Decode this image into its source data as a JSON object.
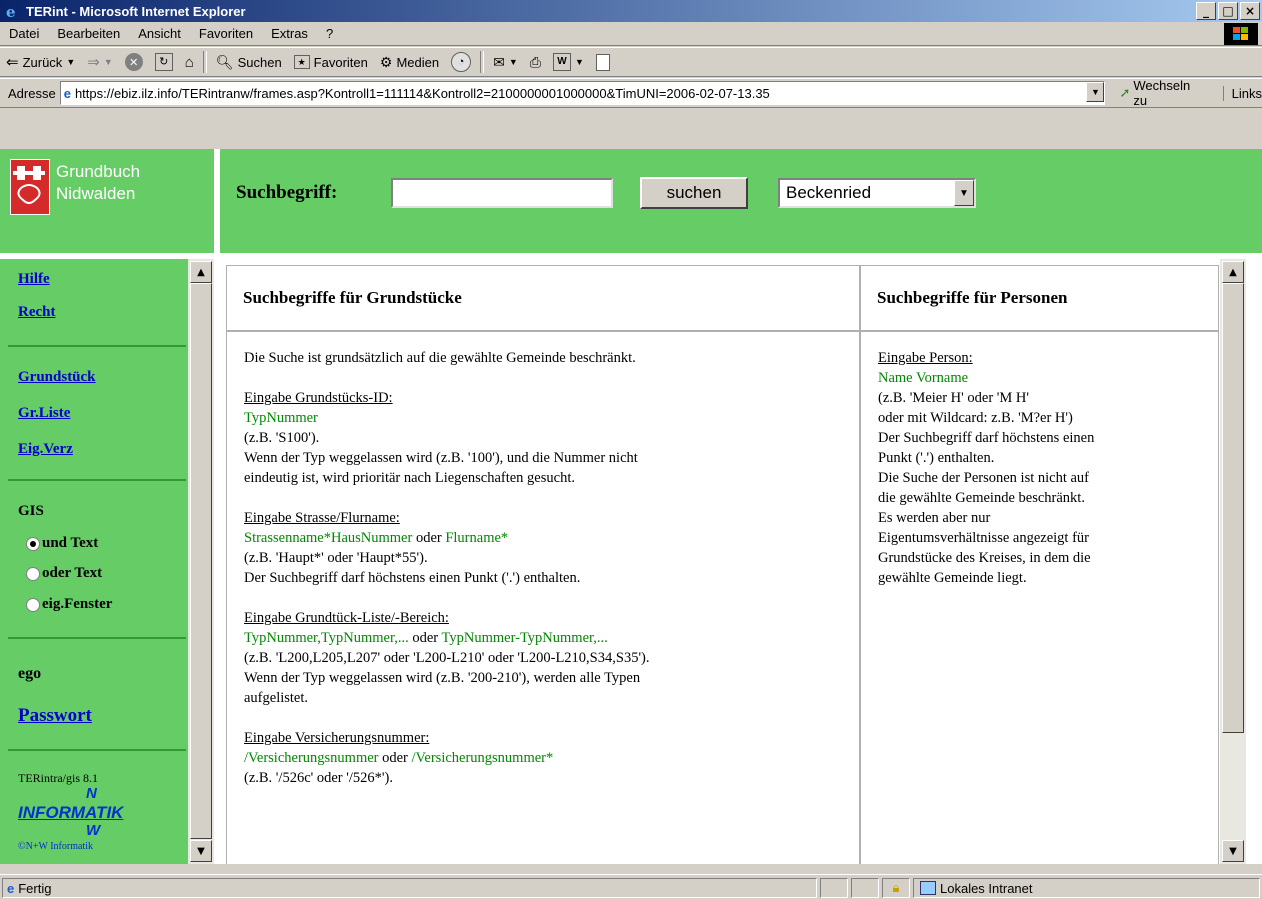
{
  "window": {
    "title": "TERint - Microsoft Internet Explorer",
    "controls": [
      "_",
      "□",
      "×"
    ]
  },
  "menu": [
    "Datei",
    "Bearbeiten",
    "Ansicht",
    "Favoriten",
    "Extras",
    "?"
  ],
  "toolbar": {
    "back": "Zurück",
    "search": "Suchen",
    "favorites": "Favoriten",
    "media": "Medien"
  },
  "address": {
    "label": "Adresse",
    "url": "https://ebiz.ilz.info/TERintranw/frames.asp?Kontroll1=111114&Kontroll2=2100000001000000&TimUNI=2006-02-07-13.35",
    "go": "Wechseln zu",
    "links": "Links"
  },
  "header": {
    "logo_line1": "Grundbuch",
    "logo_line2": "Nidwalden",
    "search_label": "Suchbegriff:",
    "search_value": "",
    "search_button": "suchen",
    "gemeinde": "Beckenried"
  },
  "nav": {
    "hilfe": "Hilfe",
    "recht": "Recht",
    "grundstueck": "Grundstück",
    "grliste": "Gr.Liste",
    "eigverz": "Eig.Verz",
    "gis": "GIS",
    "radio1": "und Text",
    "radio2": "oder Text",
    "radio3": "eig.Fenster",
    "user": "ego",
    "passwort": "Passwort",
    "version": "TERintra/gis 8.1",
    "brand": "INFORMATIK",
    "brand_n": "N",
    "brand_w": "W",
    "copyright": "©N+W Informatik"
  },
  "main": {
    "left_head": "Suchbegriffe für Grundstücke",
    "right_head": "Suchbegriffe für Personen",
    "intro": "Die Suche ist grundsätzlich auf die gewählte Gemeinde beschränkt.",
    "s1_title": "Eingabe Grundstücks-ID:",
    "s1_format": "TypNummer",
    "s1_example": "(z.B. 'S100').",
    "s1_text1": "Wenn der Typ weggelassen wird (z.B. '100'), und die Nummer nicht",
    "s1_text2": "eindeutig ist, wird prioritär nach Liegenschaften gesucht.",
    "s2_title": "Eingabe Strasse/Flurname:",
    "s2_format1": "Strassenname*HausNummer",
    "s2_or": " oder ",
    "s2_format2": "Flurname*",
    "s2_example": "(z.B. 'Haupt*' oder 'Haupt*55').",
    "s2_text": "Der Suchbegriff darf höchstens einen Punkt ('.') enthalten.",
    "s3_title": "Eingabe Grundtück-Liste/-Bereich:",
    "s3_format1": "TypNummer,TypNummer,...",
    "s3_or": " oder ",
    "s3_format2": "TypNummer-TypNummer,...",
    "s3_example": "(z.B. 'L200,L205,L207' oder 'L200-L210' oder 'L200-L210,S34,S35').",
    "s3_text1": "Wenn der Typ weggelassen wird (z.B. '200-210'), werden alle Typen",
    "s3_text2": "aufgelistet.",
    "s4_title": "Eingabe Versicherungsnummer:",
    "s4_format1": "/Versicherungsnummer",
    "s4_or": " oder ",
    "s4_format2": "/Versicherungsnummer*",
    "s4_example": "(z.B. '/526c' oder '/526*').",
    "p_title": "Eingabe Person:",
    "p_format": "Name Vorname",
    "p_l1": "(z.B. 'Meier H' oder 'M H'",
    "p_l2": "oder mit Wildcard: z.B. 'M?er H')",
    "p_l3": "Der Suchbegriff darf höchstens einen",
    "p_l4": "Punkt ('.') enthalten.",
    "p_l5": "Die Suche der Personen ist nicht auf",
    "p_l6": "die gewählte Gemeinde beschränkt.",
    "p_l7": "Es werden aber nur",
    "p_l8": "Eigentumsverhältnisse angezeigt für",
    "p_l9": "Grundstücke des Kreises, in dem die",
    "p_l10": "gewählte Gemeinde liegt."
  },
  "status": {
    "text": "Fertig",
    "zone": "Lokales Intranet"
  },
  "colors": {
    "frame_green": "#66cc66",
    "link_blue": "#0000cc",
    "format_green": "#008800",
    "titlebar": "#0a246a"
  }
}
